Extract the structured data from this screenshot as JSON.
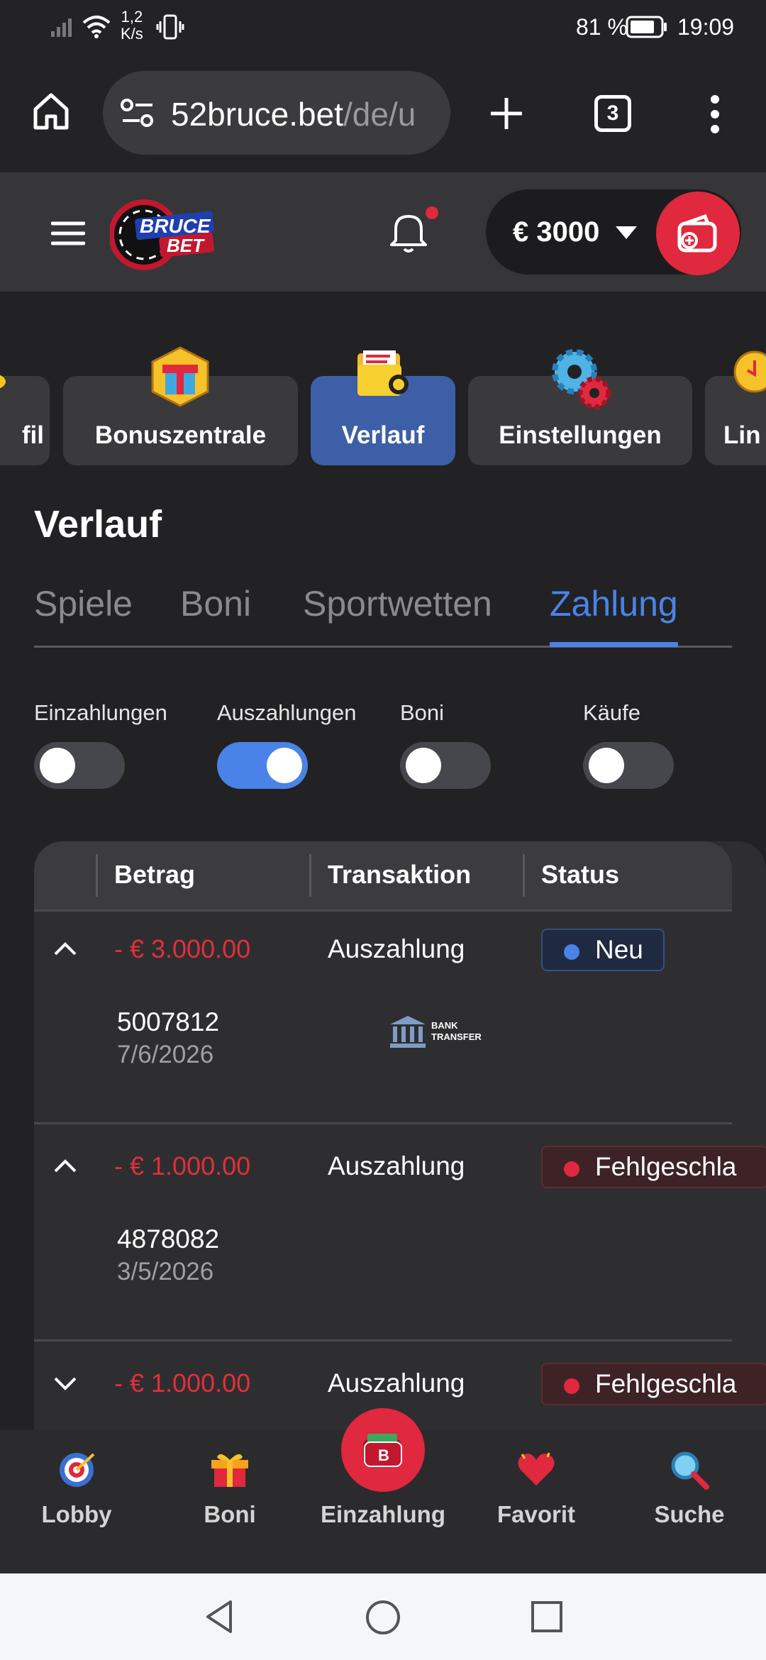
{
  "status_bar": {
    "speed_value": "1,2",
    "speed_unit": "K/s",
    "battery_pct": "81 %",
    "time": "19:09"
  },
  "browser": {
    "url_main": "52bruce.bet",
    "url_path": "/de/u",
    "tab_count": "3"
  },
  "header": {
    "logo_top": "BRUCE",
    "logo_bottom": "BET",
    "balance": "€ 3000",
    "colors": {
      "accent_red": "#e0283e",
      "notification_dot": "#e0283e"
    }
  },
  "categories": [
    {
      "label": "fil",
      "icon": "profile-icon"
    },
    {
      "label": "Bonuszentrale",
      "icon": "gift-box-icon"
    },
    {
      "label": "Verlauf",
      "icon": "history-folder-icon",
      "active": true
    },
    {
      "label": "Einstellungen",
      "icon": "gears-icon"
    },
    {
      "label": "Lin",
      "icon": "limits-icon"
    }
  ],
  "page": {
    "title": "Verlauf",
    "tabs": [
      "Spiele",
      "Boni",
      "Sportwetten",
      "Zahlung"
    ],
    "active_tab": "Zahlung"
  },
  "filters": [
    {
      "label": "Einzahlungen",
      "on": false
    },
    {
      "label": "Auszahlungen",
      "on": true
    },
    {
      "label": "Boni",
      "on": false
    },
    {
      "label": "Käufe",
      "on": false
    }
  ],
  "table": {
    "headers": [
      "Betrag",
      "Transaktion",
      "Status"
    ],
    "rows": [
      {
        "expanded": true,
        "amount": "- € 3.000.00",
        "transaction": "Auszahlung",
        "status": "Neu",
        "id": "5007812",
        "date": "7/6/2026",
        "method_line1": "BANK",
        "method_line2": "TRANSFER"
      },
      {
        "expanded": true,
        "amount": "- € 1.000.00",
        "transaction": "Auszahlung",
        "status": "Fehlgeschla",
        "id": "4878082",
        "date": "3/5/2026"
      },
      {
        "expanded": false,
        "amount": "- € 1.000.00",
        "transaction": "Auszahlung",
        "status": "Fehlgeschla"
      }
    ]
  },
  "bottom_nav": [
    {
      "label": "Lobby",
      "icon": "target-icon"
    },
    {
      "label": "Boni",
      "icon": "gift-icon"
    },
    {
      "label": "Einzahlung",
      "icon": "wallet-icon"
    },
    {
      "label": "Favorit",
      "icon": "heart-icon"
    },
    {
      "label": "Suche",
      "icon": "magnifier-icon"
    }
  ]
}
